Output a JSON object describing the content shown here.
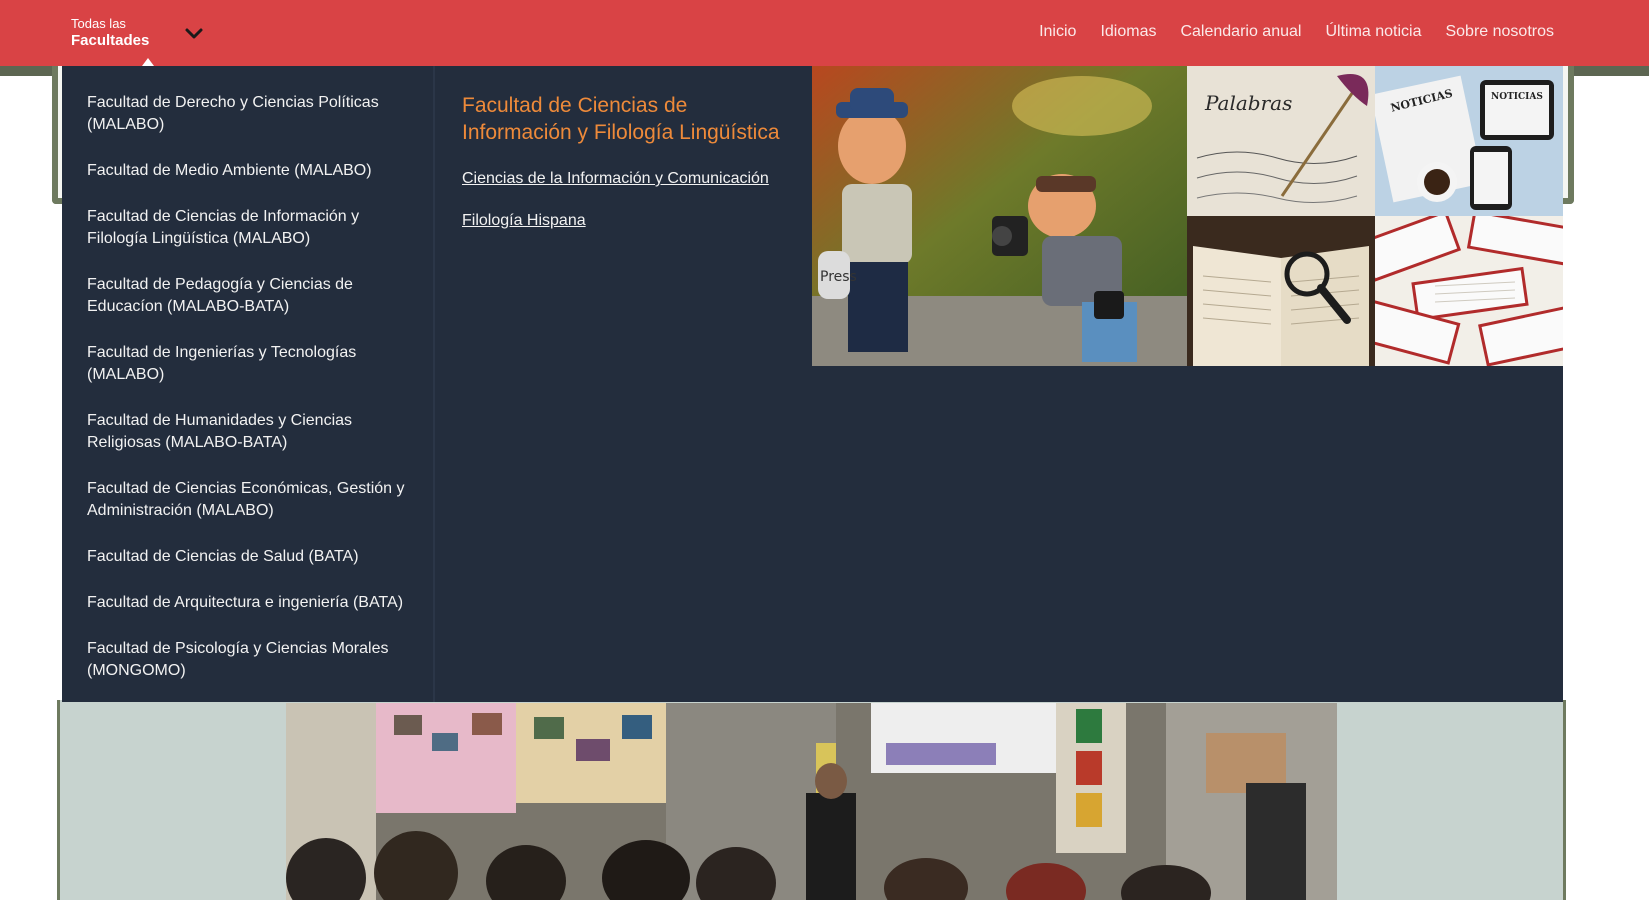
{
  "topbar": {
    "toggle_small": "Todas las",
    "toggle_big": "Facultades",
    "nav": [
      "Inicio",
      "Idiomas",
      "Calendario anual",
      "Última noticia",
      "Sobre nosotros"
    ]
  },
  "menu": {
    "faculties": [
      "Facultad de Derecho y Ciencias Políticas (MALABO)",
      "Facultad de Medio Ambiente (MALABO)",
      "Facultad de Ciencias de Información y Filología Lingüística (MALABO)",
      "Facultad de Pedagogía y Ciencias de Educacíon (MALABO-BATA)",
      "Facultad de Ingenierías y Tecnologías (MALABO)",
      "Facultad de Humanidades y Ciencias Religiosas (MALABO-BATA)",
      "Facultad de Ciencias Económicas, Gestión y Administración (MALABO)",
      "Facultad de Ciencias de Salud (BATA)",
      "Facultad de Arquitectura e ingeniería (BATA)",
      "Facultad de Psicología y Ciencias Morales (MONGOMO)"
    ],
    "selected_title": "Facultad de Ciencias de Información y Filología Lingüística",
    "subitems": [
      "Ciencias de la Información y Comunicación",
      "Filología Hispana"
    ],
    "collage_text": {
      "press": "Press",
      "palabras": "Palabras",
      "noticias": "NOTICIAS",
      "noticias2": "NOTICIAS"
    }
  },
  "colors": {
    "topbar": "#d94345",
    "menu_bg": "#232d3d",
    "accent": "#ee8a3a"
  },
  "icons": {
    "toggle": "chevron-down-icon"
  }
}
